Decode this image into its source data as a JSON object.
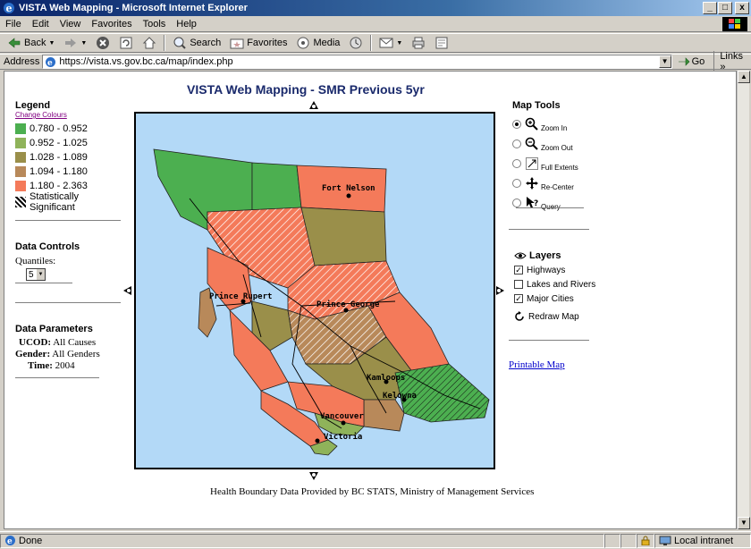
{
  "window": {
    "title": "VISTA Web Mapping - Microsoft Internet Explorer",
    "min": "_",
    "max": "□",
    "close": "x"
  },
  "menu": [
    "File",
    "Edit",
    "View",
    "Favorites",
    "Tools",
    "Help"
  ],
  "toolbar": {
    "back": "Back",
    "search": "Search",
    "favorites": "Favorites",
    "media": "Media"
  },
  "address": {
    "label": "Address",
    "url": "https://vista.vs.gov.bc.ca/map/index.php",
    "go": "Go",
    "links": "Links"
  },
  "page": {
    "title": "VISTA Web Mapping - SMR Previous 5yr",
    "credit": "Health Boundary Data Provided by BC STATS, Ministry of Management Services",
    "print_link": "Printable Map"
  },
  "legend": {
    "title": "Legend",
    "change_colours": "Change Colours",
    "items": [
      {
        "label": "0.780 - 0.952",
        "color": "#4caf50"
      },
      {
        "label": "0.952 - 1.025",
        "color": "#8fb35a"
      },
      {
        "label": "1.028 - 1.089",
        "color": "#9a8f4a"
      },
      {
        "label": "1.094 - 1.180",
        "color": "#b8895a"
      },
      {
        "label": "1.180 - 2.363",
        "color": "#f47a5a"
      }
    ],
    "significant": "Statistically Significant"
  },
  "data_controls": {
    "title": "Data Controls",
    "quantiles_label": "Quantiles:",
    "quantiles_value": "5"
  },
  "data_parameters": {
    "title": "Data Parameters",
    "ucod_label": "UCOD:",
    "ucod_value": "All Causes",
    "gender_label": "Gender:",
    "gender_value": "All Genders",
    "time_label": "Time:",
    "time_value": "2004"
  },
  "map_tools": {
    "title": "Map Tools",
    "items": [
      {
        "label": "Zoom In",
        "icon": "zoom-in-icon",
        "selected": true
      },
      {
        "label": "Zoom Out",
        "icon": "zoom-out-icon",
        "selected": false
      },
      {
        "label": "Full Extents",
        "icon": "full-extents-icon",
        "selected": false
      },
      {
        "label": "Re-Center",
        "icon": "re-center-icon",
        "selected": false
      },
      {
        "label": "Query",
        "icon": "query-icon",
        "selected": false
      }
    ]
  },
  "layers": {
    "title": "Layers",
    "items": [
      {
        "label": "Highways",
        "checked": true
      },
      {
        "label": "Lakes and Rivers",
        "checked": false
      },
      {
        "label": "Major Cities",
        "checked": true
      }
    ],
    "redraw": "Redraw Map"
  },
  "cities": [
    "Fort Nelson",
    "Prince Rupert",
    "Prince George",
    "Kamloops",
    "Kelowna",
    "Vancouver",
    "Victoria"
  ],
  "status": {
    "text": "Done",
    "zone": "Local intranet"
  }
}
